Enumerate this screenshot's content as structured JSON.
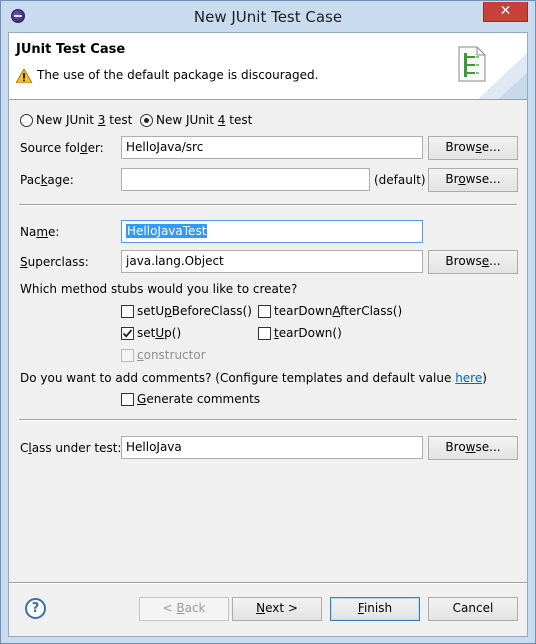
{
  "window": {
    "title": "New JUnit Test Case",
    "close_glyph": "✕"
  },
  "banner": {
    "title": "JUnit Test Case",
    "message": "The use of the default package is discouraged."
  },
  "version": {
    "junit3": {
      "pre": "New JUnit ",
      "key": "3",
      "post": " test",
      "selected": false
    },
    "junit4": {
      "pre": "New JUnit ",
      "key": "4",
      "post": " test",
      "selected": true
    }
  },
  "source_folder": {
    "label_pre": "Source fol",
    "label_key": "d",
    "label_post": "er:",
    "value": "HelloJava/src",
    "browse_pre": "Brow",
    "browse_key": "s",
    "browse_post": "e..."
  },
  "package": {
    "label_pre": "Pac",
    "label_key": "k",
    "label_post": "age:",
    "value": "",
    "note": "(default)",
    "browse_pre": "Br",
    "browse_key": "o",
    "browse_post": "wse..."
  },
  "name": {
    "label_pre": "Na",
    "label_key": "m",
    "label_post": "e:",
    "value": "HelloJavaTest"
  },
  "superclass": {
    "label_key": "S",
    "label_post": "uperclass:",
    "value": "java.lang.Object",
    "browse_pre": "Brows",
    "browse_key": "e",
    "browse_post": "..."
  },
  "stubs": {
    "question": "Which method stubs would you like to create?",
    "setUpBeforeClass": {
      "pre": "setU",
      "key": "p",
      "post": "BeforeClass()",
      "checked": false
    },
    "tearDownAfterClass": {
      "pre": "tearDown",
      "key": "A",
      "post": "fterClass()",
      "checked": false
    },
    "setUp": {
      "pre": "set",
      "key": "U",
      "post": "p()",
      "checked": true
    },
    "tearDown": {
      "key": "t",
      "post": "earDown()",
      "checked": false
    },
    "constructor": {
      "key": "c",
      "post": "onstructor",
      "checked": false,
      "enabled": false
    }
  },
  "comments": {
    "question": "Do you want to add comments? (Configure templates and default value ",
    "link": "here",
    "close": ")",
    "generate": {
      "key": "G",
      "post": "enerate comments",
      "checked": false
    }
  },
  "class_under_test": {
    "label_pre": "C",
    "label_key": "l",
    "label_post": "ass under test:",
    "value": "HelloJava",
    "browse_pre": "Bro",
    "browse_key": "w",
    "browse_post": "se..."
  },
  "footer": {
    "help_glyph": "?",
    "back": {
      "pre": "< ",
      "key": "B",
      "post": "ack",
      "enabled": false
    },
    "next": {
      "key": "N",
      "post": "ext >"
    },
    "finish": {
      "key": "F",
      "post": "inish"
    },
    "cancel": "Cancel"
  },
  "colors": {
    "accent": "#3399ff",
    "link": "#0066cc",
    "close": "#c7403a"
  }
}
